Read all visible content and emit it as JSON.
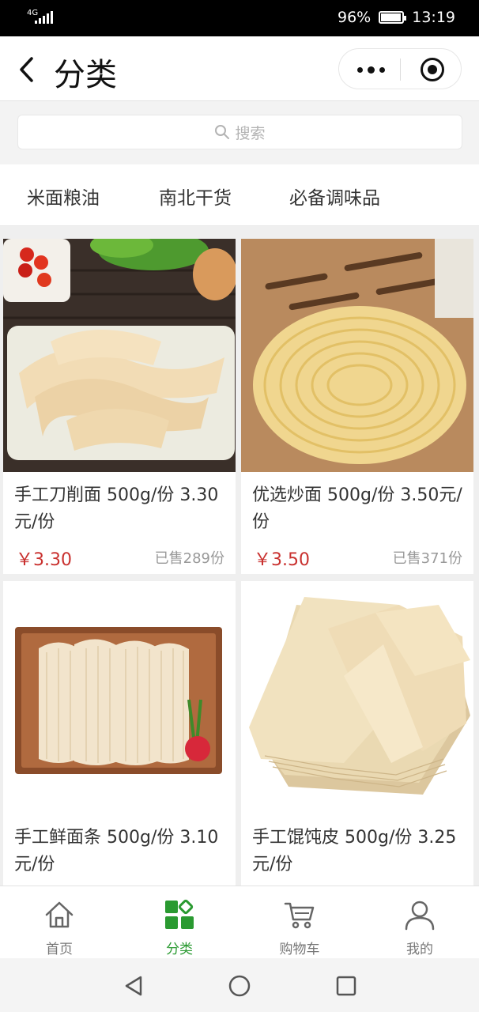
{
  "status_bar": {
    "network": "4G",
    "battery": "96%",
    "battery_level": 0.96,
    "time": "13:19"
  },
  "nav": {
    "title": "分类",
    "icons": [
      "back-chevron-icon",
      "more-dots-icon",
      "close-target-icon"
    ]
  },
  "search": {
    "placeholder": "搜索",
    "icon": "search-icon"
  },
  "category_tabs": [
    "米面粮油",
    "南北干货",
    "必备调味品"
  ],
  "products": [
    {
      "title": "手工刀削面 500g/份 3.30元/份",
      "price": "￥3.30",
      "sold": "已售289份"
    },
    {
      "title": "优选炒面 500g/份 3.50元/份",
      "price": "￥3.50",
      "sold": "已售371份"
    },
    {
      "title": "手工鲜面条 500g/份 3.10元/份",
      "price": "",
      "sold": ""
    },
    {
      "title": "手工馄饨皮 500g/份 3.25元/份",
      "price": "",
      "sold": ""
    }
  ],
  "tab_bar": {
    "items": [
      {
        "label": "首页",
        "icon": "home-icon"
      },
      {
        "label": "分类",
        "icon": "category-icon",
        "active": true
      },
      {
        "label": "购物车",
        "icon": "cart-icon"
      },
      {
        "label": "我的",
        "icon": "profile-icon"
      }
    ]
  },
  "colors": {
    "accent": "#2a9a31",
    "price": "#c9312f",
    "text": "#333333",
    "muted": "#999999"
  }
}
